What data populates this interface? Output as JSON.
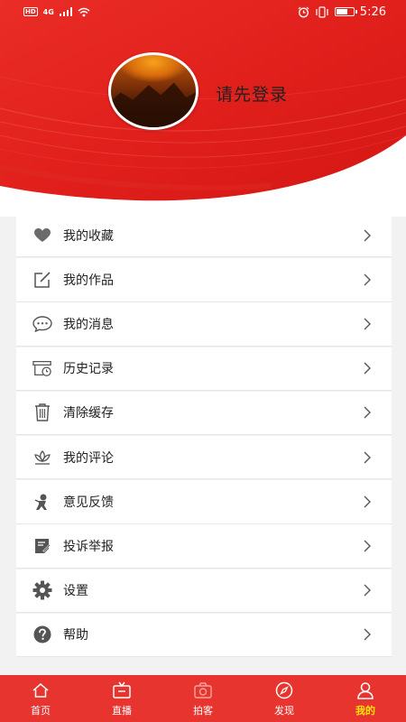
{
  "status_bar": {
    "hd": "HD",
    "network": "4G",
    "time": "5:26"
  },
  "profile": {
    "login_prompt": "请先登录"
  },
  "menu": {
    "items": [
      {
        "label": "我的收藏",
        "icon": "heart-icon"
      },
      {
        "label": "我的作品",
        "icon": "edit-icon"
      },
      {
        "label": "我的消息",
        "icon": "message-icon"
      },
      {
        "label": "历史记录",
        "icon": "history-icon"
      },
      {
        "label": "清除缓存",
        "icon": "trash-icon"
      },
      {
        "label": "我的评论",
        "icon": "lotus-icon"
      },
      {
        "label": "意见反馈",
        "icon": "feedback-icon"
      },
      {
        "label": "投诉举报",
        "icon": "report-icon"
      },
      {
        "label": "设置",
        "icon": "gear-icon"
      },
      {
        "label": "帮助",
        "icon": "help-icon"
      }
    ]
  },
  "tabbar": {
    "tabs": [
      {
        "label": "首页",
        "icon": "home-icon"
      },
      {
        "label": "直播",
        "icon": "tv-icon"
      },
      {
        "label": "拍客",
        "icon": "camera-icon"
      },
      {
        "label": "发现",
        "icon": "compass-icon"
      },
      {
        "label": "我的",
        "icon": "user-icon",
        "active": true
      }
    ]
  },
  "colors": {
    "brand_red": "#e7342f",
    "active_tab": "#ffe600",
    "icon_gray": "#666666"
  }
}
